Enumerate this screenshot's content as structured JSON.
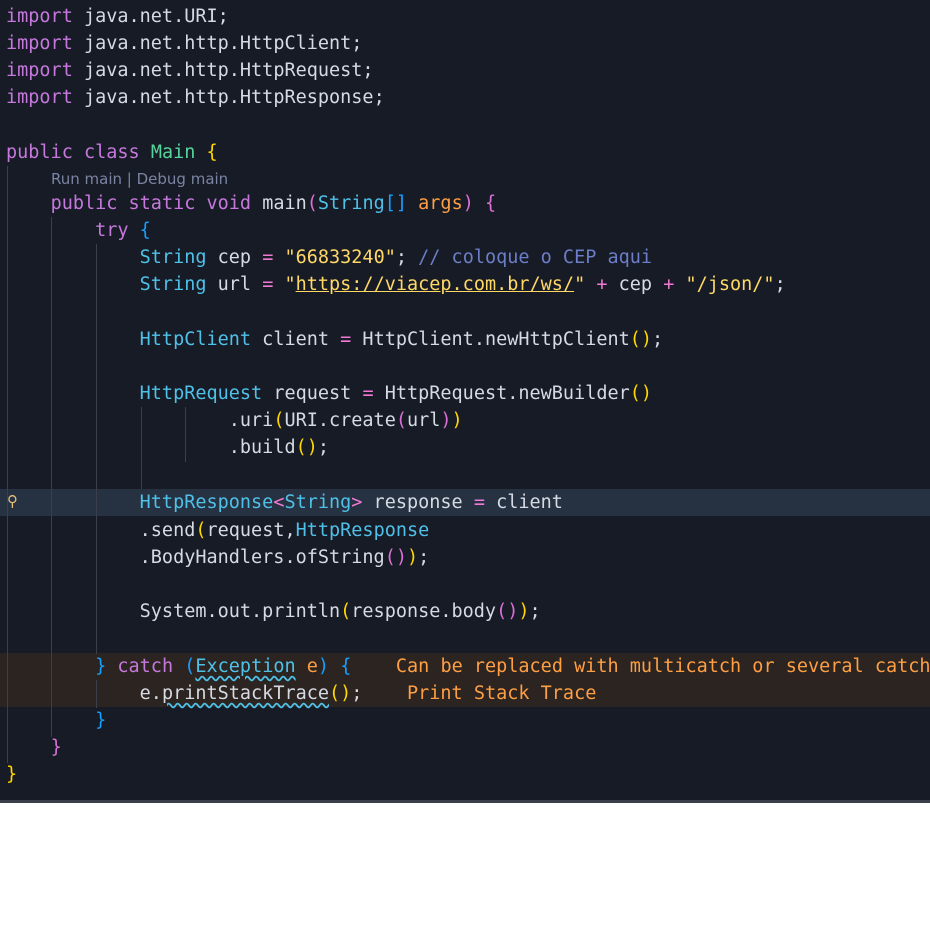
{
  "editor": {
    "codelens": {
      "run": "Run main",
      "sep": " | ",
      "debug": "Debug main"
    },
    "imports": [
      "java.net.URI",
      "java.net.http.HttpClient",
      "java.net.http.HttpRequest",
      "java.net.http.HttpResponse"
    ],
    "keywords": {
      "import": "import",
      "public": "public",
      "class": "class",
      "static": "static",
      "void": "void",
      "try": "try",
      "catch": "catch"
    },
    "class_name": "Main",
    "method_name": "main",
    "param_type": "String",
    "param_name": "args",
    "cep_value": "\"66833240\"",
    "cep_comment": "// coloque o CEP aqui",
    "url_value": "https://viacep.com.br/ws/",
    "json_suffix": "\"/json/\"",
    "inline_hint_catch": "Can be replaced with multicatch or several catch",
    "inline_hint_print": "Print Stack Trace",
    "colors": {
      "background": "#171b26",
      "keyword": "#c678dd",
      "type": "#4fc1e9",
      "string": "#ffd866",
      "warning": "#ff9f43"
    }
  }
}
